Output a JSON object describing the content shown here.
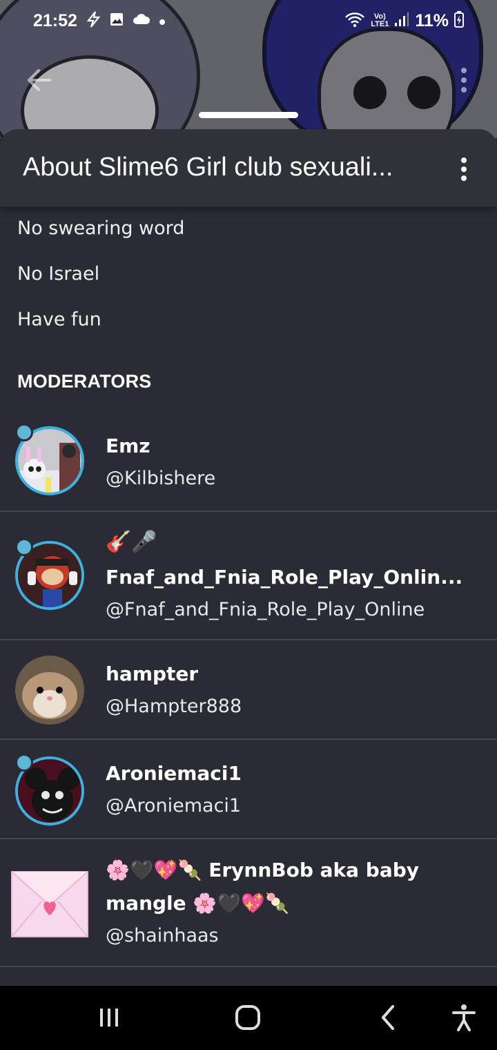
{
  "status_bar": {
    "time": "21:52",
    "battery": "11%",
    "network": "Vo)\nLTE1",
    "icons": [
      "lightning-icon",
      "image-icon",
      "cloud-icon",
      "dot-icon",
      "wifi-icon",
      "signal-icon",
      "battery-charging-icon"
    ]
  },
  "header": {
    "title": "About Slime6 Girl club sexuali..."
  },
  "rules": [
    "No swearing word",
    "No Israel",
    "Have fun"
  ],
  "section_heading": "MODERATORS",
  "moderators": [
    {
      "name": "Emz",
      "handle": "@Kilbishere",
      "emoji": "",
      "frame": true
    },
    {
      "name": "Fnaf_and_Fnia_Role_Play_Onlin...",
      "handle": "@Fnaf_and_Fnia_Role_Play_Online",
      "emoji": "🎸🎤",
      "frame": true
    },
    {
      "name": "hampter",
      "handle": "@Hampter888",
      "emoji": "",
      "frame": false
    },
    {
      "name": "Aroniemaci1",
      "handle": "@Aroniemaci1",
      "emoji": "",
      "frame": true
    },
    {
      "name_line1": "🌸🖤💖🍡 ErynnBob aka baby",
      "name_line2": "mangle 🌸🖤💖🍡",
      "handle": "@shainhaas",
      "frame": false
    }
  ],
  "colors": {
    "background": "#2b2b35",
    "header": "#313139",
    "frame_ring": "#3ab3e0",
    "divider": "#45454f"
  }
}
